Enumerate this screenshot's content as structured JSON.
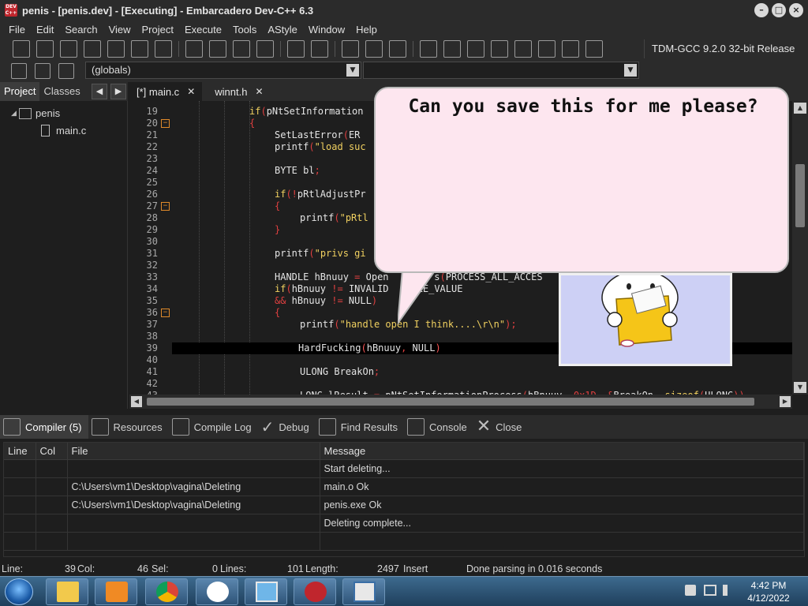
{
  "window": {
    "title": "penis - [penis.dev] - [Executing] - Embarcadero Dev-C++ 6.3",
    "app_icon_label": "DEV C++",
    "controls": [
      "minimize",
      "maximize",
      "close"
    ]
  },
  "menu": [
    "File",
    "Edit",
    "Search",
    "View",
    "Project",
    "Execute",
    "Tools",
    "AStyle",
    "Window",
    "Help"
  ],
  "toolbar": {
    "compiler": "TDM-GCC 9.2.0 32-bit Release",
    "globals_value": "(globals)"
  },
  "project_panel": {
    "tabs": [
      "Project",
      "Classes"
    ],
    "active_tab": "Project",
    "tree": {
      "project": "penis",
      "files": [
        "main.c"
      ]
    }
  },
  "editor": {
    "tabs": [
      {
        "label": "[*] main.c",
        "active": true
      },
      {
        "label": "winnt.h",
        "active": false
      }
    ],
    "line_numbers": [
      "19",
      "20",
      "21",
      "22",
      "23",
      "24",
      "25",
      "26",
      "27",
      "28",
      "29",
      "30",
      "31",
      "32",
      "33",
      "34",
      "35",
      "36",
      "37",
      "38",
      "39",
      "40",
      "41",
      "42",
      "43"
    ],
    "fold_lines": [
      "20",
      "27",
      "36"
    ],
    "lines": [
      "if(pNtSetInformation",
      "{",
      "SetLastError(ER",
      "printf(\"load suc",
      "",
      "BYTE bl;",
      "",
      "if(!pRtlAdjustPr",
      "{",
      "printf(\"pRtl",
      "}",
      "",
      "printf(\"privs gi",
      "",
      "HANDLE hBnuuy = Open        s(PROCESS_ALL_ACCES",
      "if(hBnuuy != INVALID    DLE_VALUE",
      "&& hBnuuy != NULL)",
      "{",
      "printf(\"handle open I think....\\r\\n\");",
      "",
      "HardFucking(hBnuuy, NULL)",
      "",
      "ULONG BreakOn;",
      "",
      "LONG lResult = pNtSetInformationProcess(hBnuuy, 0x1D, &BreakOn, sizeof(ULONG))"
    ]
  },
  "overlay": {
    "bubble_text": "Can you save this for me please?"
  },
  "bottom_panel": {
    "tabs": [
      "Compiler (5)",
      "Resources",
      "Compile Log",
      "Debug",
      "Find Results",
      "Console",
      "Close"
    ],
    "active_tab": "Compiler (5)",
    "columns": [
      "Line",
      "Col",
      "File",
      "Message"
    ],
    "rows": [
      {
        "line": "",
        "col": "",
        "file": "",
        "message": "Start deleting..."
      },
      {
        "line": "",
        "col": "",
        "file": "C:\\Users\\vm1\\Desktop\\vagina\\Deleting",
        "message": "main.o Ok"
      },
      {
        "line": "",
        "col": "",
        "file": "C:\\Users\\vm1\\Desktop\\vagina\\Deleting",
        "message": "penis.exe Ok"
      },
      {
        "line": "",
        "col": "",
        "file": "",
        "message": "Deleting complete..."
      },
      {
        "line": "",
        "col": "",
        "file": "",
        "message": ""
      }
    ]
  },
  "status": {
    "line_label": "Line:",
    "line_value": "39",
    "col_label": "Col:",
    "col_value": "46",
    "sel_label": "Sel:",
    "sel_value": "0",
    "lines_label": "Lines:",
    "lines_value": "101",
    "length_label": "Length:",
    "length_value": "2497",
    "mode": "Insert",
    "message": "Done parsing in 0.016 seconds"
  },
  "taskbar": {
    "apps": [
      "explorer-icon",
      "media-player-icon",
      "chrome-icon",
      "bunny-app-icon",
      "picture-app-icon",
      "devcpp-icon",
      "window-app-icon"
    ],
    "time": "4:42 PM",
    "date": "4/12/2022"
  },
  "colors": {
    "accent_keyword": "#f0d060",
    "bracket_red": "#e04040",
    "bubble_pink": "#fde6ef",
    "fold_orange": "#e08a2a"
  }
}
